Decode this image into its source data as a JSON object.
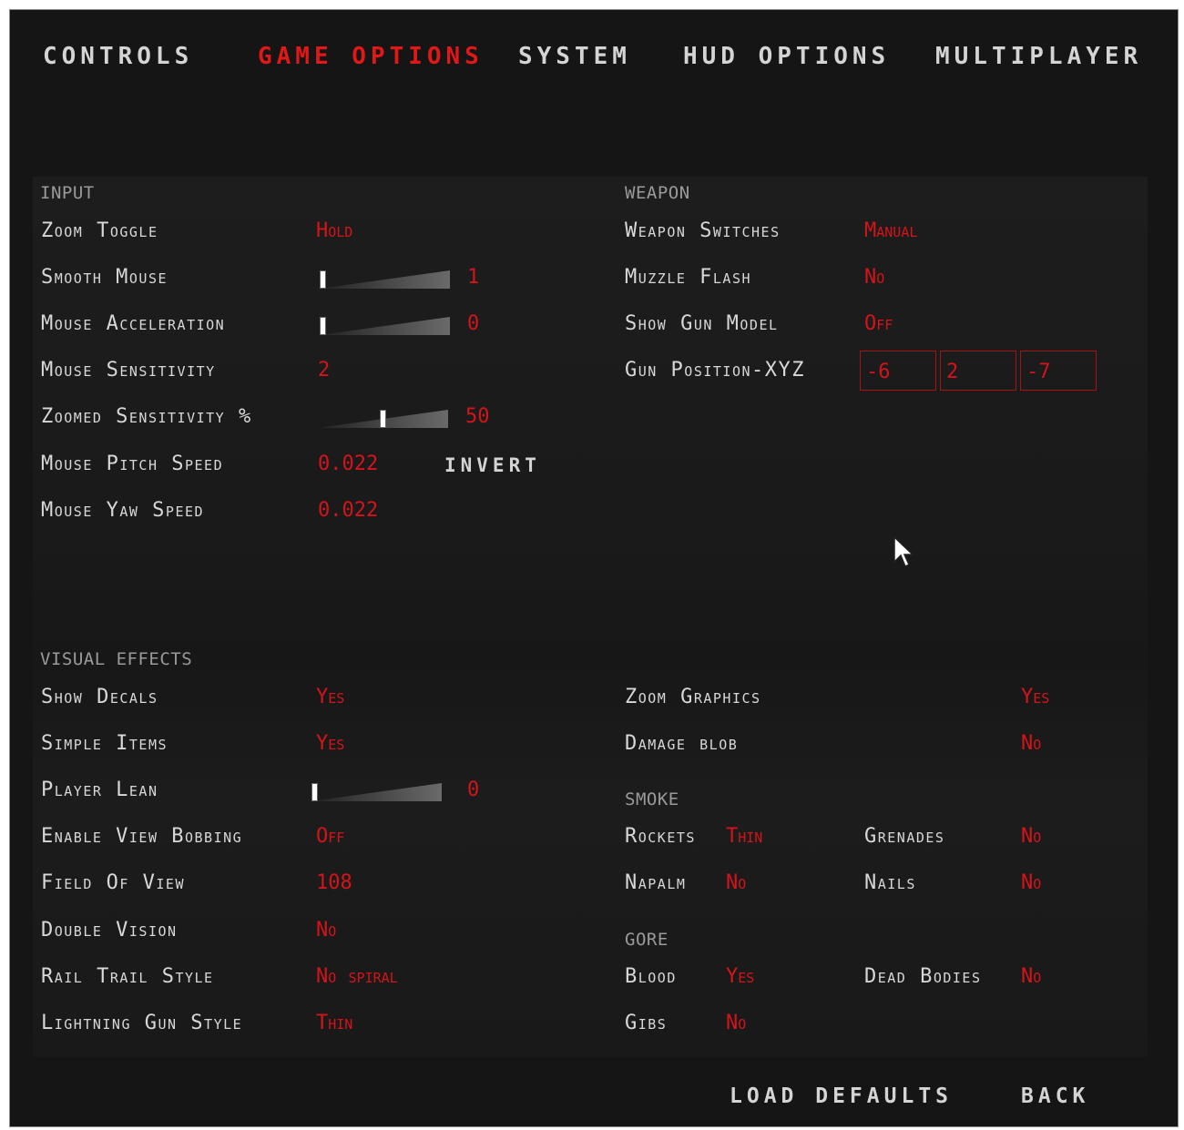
{
  "tabs": [
    "CONTROLS",
    "GAME OPTIONS",
    "SYSTEM",
    "HUD OPTIONS",
    "MULTIPLAYER"
  ],
  "active_tab": "GAME OPTIONS",
  "input": {
    "title": "INPUT",
    "zoom_toggle": {
      "label": "Zoom Toggle",
      "value": "Hold"
    },
    "smooth_mouse": {
      "label": "Smooth Mouse",
      "value": "1",
      "level": 0.0
    },
    "mouse_acceleration": {
      "label": "Mouse Acceleration",
      "value": "0",
      "level": 0.0
    },
    "mouse_sensitivity": {
      "label": "Mouse Sensitivity",
      "value": "2"
    },
    "zoomed_sensitivity": {
      "label": "Zoomed Sensitivity %",
      "value": "50",
      "level": 0.5
    },
    "mouse_pitch_speed": {
      "label": "Mouse Pitch Speed",
      "value": "0.022",
      "invert_label": "INVERT"
    },
    "mouse_yaw_speed": {
      "label": "Mouse Yaw Speed",
      "value": "0.022"
    }
  },
  "weapon": {
    "title": "WEAPON",
    "weapon_switches": {
      "label": "Weapon Switches",
      "value": "Manual"
    },
    "muzzle_flash": {
      "label": "Muzzle Flash",
      "value": "No"
    },
    "show_gun_model": {
      "label": "Show Gun Model",
      "value": "Off"
    },
    "gun_position": {
      "label": "Gun Position-XYZ",
      "x": "-6",
      "y": "2",
      "z": "-7"
    }
  },
  "visual": {
    "title": "VISUAL EFFECTS",
    "show_decals": {
      "label": "Show Decals",
      "value": "Yes"
    },
    "simple_items": {
      "label": "Simple Items",
      "value": "Yes"
    },
    "player_lean": {
      "label": "Player Lean",
      "value": "0",
      "level": 0.0
    },
    "enable_view_bobbing": {
      "label": "Enable View Bobbing",
      "value": "Off"
    },
    "field_of_view": {
      "label": "Field Of View",
      "value": "108"
    },
    "double_vision": {
      "label": "Double Vision",
      "value": "No"
    },
    "rail_trail_style": {
      "label": "Rail Trail Style",
      "value": "No spiral"
    },
    "lightning_gun_style": {
      "label": "Lightning Gun Style",
      "value": "Thin"
    },
    "zoom_graphics": {
      "label": "Zoom Graphics",
      "value": "Yes"
    },
    "damage_blob": {
      "label": "Damage blob",
      "value": "No"
    }
  },
  "smoke": {
    "title": "SMOKE",
    "rockets": {
      "label": "Rockets",
      "value": "Thin"
    },
    "grenades": {
      "label": "Grenades",
      "value": "No"
    },
    "napalm": {
      "label": "Napalm",
      "value": "No"
    },
    "nails": {
      "label": "Nails",
      "value": "No"
    }
  },
  "gore": {
    "title": "GORE",
    "blood": {
      "label": "Blood",
      "value": "Yes"
    },
    "dead_bodies": {
      "label": "Dead Bodies",
      "value": "No"
    },
    "gibs": {
      "label": "Gibs",
      "value": "No"
    }
  },
  "footer": {
    "load_defaults": "LOAD DEFAULTS",
    "back": "BACK"
  },
  "colors": {
    "background": "#151515",
    "panel": "#1b1b1b",
    "label": "#d8d8d8",
    "value": "#d4141a",
    "active_tab": "#e01818"
  }
}
